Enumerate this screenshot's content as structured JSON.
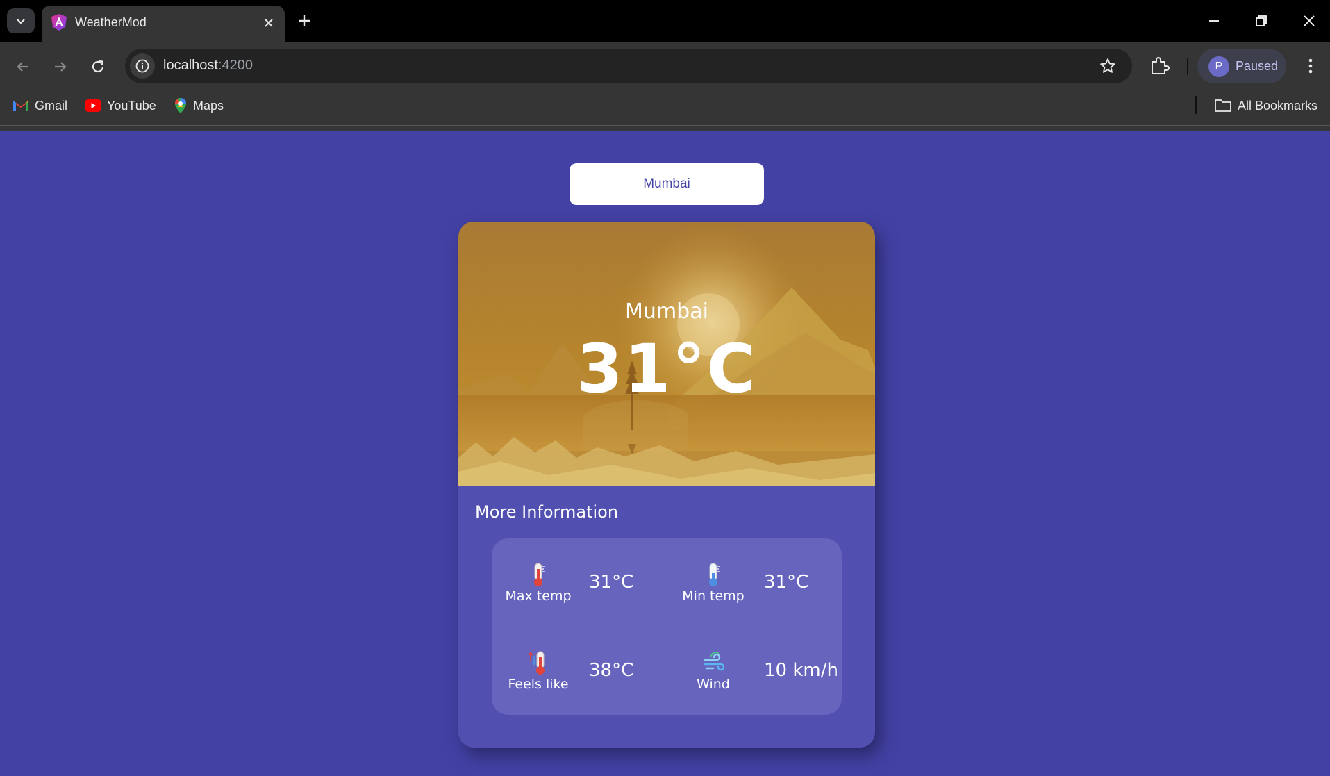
{
  "browser": {
    "tab_title": "WeatherMod",
    "url_host": "localhost",
    "url_port": ":4200",
    "profile_initial": "P",
    "profile_status": "Paused",
    "bookmarks": [
      {
        "label": "Gmail",
        "icon": "gmail-icon"
      },
      {
        "label": "YouTube",
        "icon": "youtube-icon"
      },
      {
        "label": "Maps",
        "icon": "maps-icon"
      }
    ],
    "all_bookmarks": "All Bookmarks"
  },
  "page": {
    "city_button": "Mumbai",
    "hero": {
      "city": "Mumbai",
      "temperature": "31°C"
    },
    "more_info_title": "More Information",
    "stats": [
      {
        "label": "Max temp",
        "value": "31°C",
        "icon": "thermometer-hot-icon"
      },
      {
        "label": "Min temp",
        "value": "31°C",
        "icon": "thermometer-cold-icon"
      },
      {
        "label": "Feels like",
        "value": "38°C",
        "icon": "feels-like-thermometer-icon"
      },
      {
        "label": "Wind",
        "value": "10 km/h",
        "icon": "wind-icon"
      }
    ]
  },
  "colors": {
    "page_background": "#4342a4",
    "card_background": "#5150b0",
    "info_panel": "#6664bd",
    "hero_sky": "#b07e32",
    "accent": "#4342a4"
  }
}
